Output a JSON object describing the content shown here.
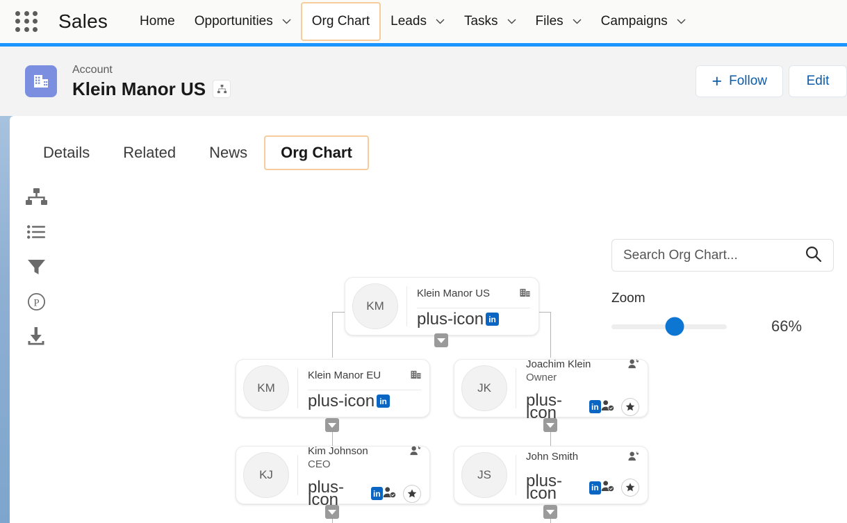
{
  "global_nav": {
    "app_launcher_icon": "app-launcher-grid-icon",
    "app_name": "Sales",
    "items": [
      {
        "label": "Home",
        "has_caret": false,
        "active": false
      },
      {
        "label": "Opportunities",
        "has_caret": true,
        "active": false
      },
      {
        "label": "Org Chart",
        "has_caret": false,
        "active": true
      },
      {
        "label": "Leads",
        "has_caret": true,
        "active": false
      },
      {
        "label": "Tasks",
        "has_caret": true,
        "active": false
      },
      {
        "label": "Files",
        "has_caret": true,
        "active": false
      },
      {
        "label": "Campaigns",
        "has_caret": true,
        "active": false
      }
    ]
  },
  "record_header": {
    "object_icon": "account-building-icon",
    "object_label": "Account",
    "record_title": "Klein Manor US",
    "orgchart_chip_icon": "hierarchy-icon",
    "follow_label": "Follow",
    "follow_icon": "plus-icon",
    "edit_label": "Edit"
  },
  "tabs": [
    {
      "label": "Details",
      "active": false
    },
    {
      "label": "Related",
      "active": false
    },
    {
      "label": "News",
      "active": false
    },
    {
      "label": "Org Chart",
      "active": true
    }
  ],
  "toolbar": [
    {
      "icon": "hierarchy-icon",
      "name": "tool-org-chart"
    },
    {
      "icon": "list-icon",
      "name": "tool-list-view"
    },
    {
      "icon": "filter-funnel-icon",
      "name": "tool-filter"
    },
    {
      "icon": "p-circle-icon",
      "name": "tool-power"
    },
    {
      "icon": "download-icon",
      "name": "tool-export"
    }
  ],
  "search": {
    "placeholder": "Search Org Chart...",
    "value": "",
    "icon": "search-icon"
  },
  "zoom": {
    "label": "Zoom",
    "value": "66%",
    "percent": 55,
    "accent_color": "#0d76d3"
  },
  "colors": {
    "nav_rule": "#1b96ff",
    "tab_active_border": "#f6cd9a",
    "account_icon_bg": "#7c8ee0",
    "linkedin_blue": "#0a66c2",
    "button_text": "#0b5cab"
  },
  "org_chart": {
    "nodes": [
      {
        "id": "root",
        "initials": "KM",
        "title": "Klein Manor US",
        "subtitle": "",
        "corner_icon": "building-icon",
        "add_icon": "plus-icon",
        "linkedin_label": "in",
        "has_contact_actions": false,
        "level": 0
      },
      {
        "id": "klein-manor-eu",
        "initials": "KM",
        "title": "Klein Manor EU",
        "subtitle": "",
        "corner_icon": "building-icon",
        "add_icon": "plus-icon",
        "linkedin_label": "in",
        "has_contact_actions": false,
        "level": 1
      },
      {
        "id": "joachim-klein",
        "initials": "JK",
        "title": "Joachim Klein",
        "subtitle": "Owner",
        "corner_icon": "contact-add-icon",
        "add_icon": "plus-icon",
        "linkedin_label": "in",
        "has_contact_actions": true,
        "contact_icon": "contact-check-icon",
        "star_icon": "star-icon",
        "level": 1
      },
      {
        "id": "kim-johnson",
        "initials": "KJ",
        "title": "Kim Johnson",
        "subtitle": "CEO",
        "corner_icon": "contact-add-icon",
        "add_icon": "plus-icon",
        "linkedin_label": "in",
        "has_contact_actions": true,
        "contact_icon": "contact-check-icon",
        "star_icon": "star-icon",
        "level": 2
      },
      {
        "id": "john-smith",
        "initials": "JS",
        "title": "John Smith",
        "subtitle": "",
        "corner_icon": "contact-add-icon",
        "add_icon": "plus-icon",
        "linkedin_label": "in",
        "has_contact_actions": true,
        "contact_icon": "contact-check-icon",
        "star_icon": "star-icon",
        "level": 2
      }
    ]
  }
}
